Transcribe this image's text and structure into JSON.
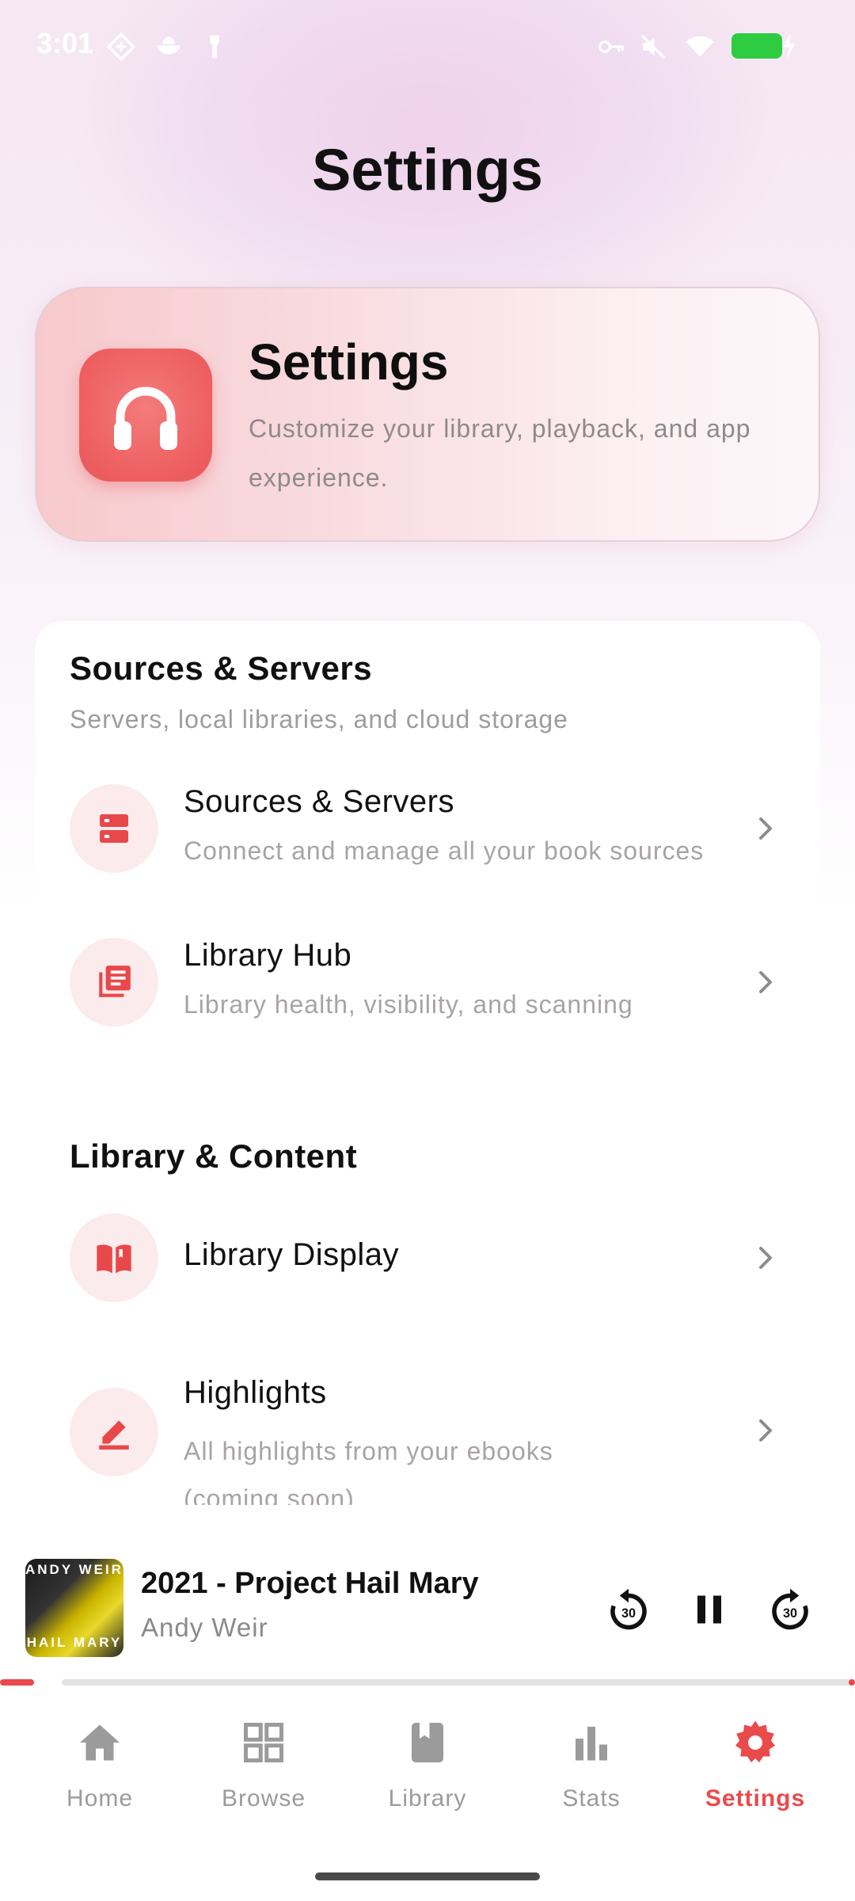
{
  "status_bar": {
    "time": "3:01",
    "icons": [
      "signal-diamond-icon",
      "bowl-icon",
      "tag-icon",
      "key-icon",
      "mute-icon",
      "wifi-icon",
      "battery-icon",
      "charging-icon"
    ]
  },
  "header": {
    "title": "Settings"
  },
  "hero": {
    "title": "Settings",
    "subtitle": "Customize your library, playback, and app experience.",
    "icon": "headphones-icon"
  },
  "sections": [
    {
      "title": "Sources & Servers",
      "subtitle": "Servers, local libraries, and cloud storage",
      "items": [
        {
          "title": "Sources & Servers",
          "subtitle": "Connect and manage all your book sources",
          "icon": "server-icon"
        },
        {
          "title": "Library Hub",
          "subtitle": "Library health, visibility, and scanning",
          "icon": "library-icon"
        }
      ]
    },
    {
      "title": "Library & Content",
      "items": [
        {
          "title": "Library Display",
          "icon": "open-book-icon"
        },
        {
          "title": "Highlights",
          "subtitle": "All highlights from your ebooks (coming soon)",
          "icon": "highlighter-icon"
        }
      ]
    }
  ],
  "player": {
    "title": "2021 - Project Hail Mary",
    "author": "Andy Weir",
    "cover_top": "ANDY WEIR",
    "cover_bottom": "HAIL MARY",
    "progress_fraction": 0.04
  },
  "nav": {
    "items": [
      {
        "label": "Home",
        "icon": "home-icon"
      },
      {
        "label": "Browse",
        "icon": "grid-icon"
      },
      {
        "label": "Library",
        "icon": "book-icon"
      },
      {
        "label": "Stats",
        "icon": "bar-chart-icon"
      },
      {
        "label": "Settings",
        "icon": "gear-icon"
      }
    ],
    "active": "Settings"
  },
  "colors": {
    "accent": "#ea4a4c",
    "inactive": "#9b9b9b",
    "icon_bg": "#fcebec"
  }
}
